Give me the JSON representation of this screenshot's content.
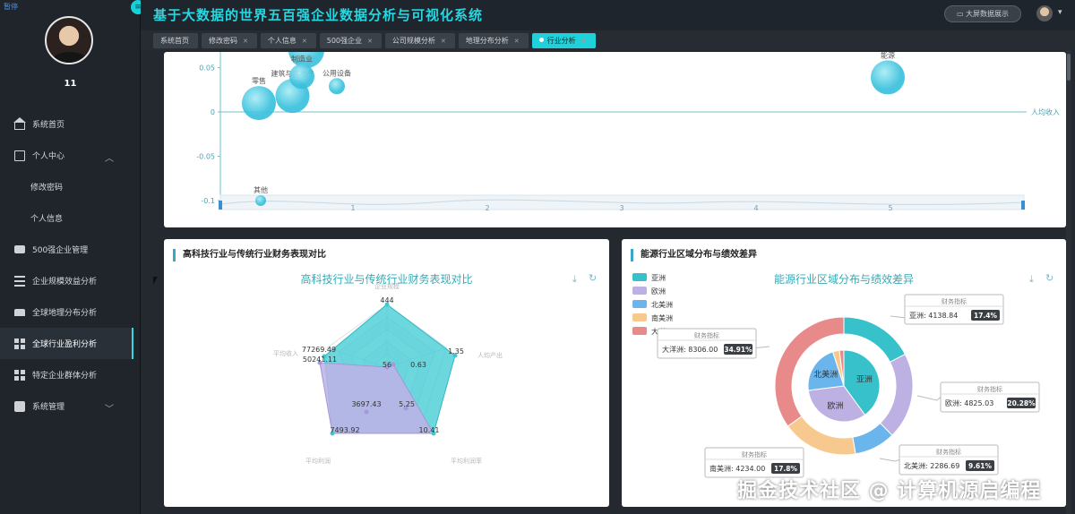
{
  "sidebar": {
    "pause_label": "暂停",
    "user_name": "11",
    "items": [
      {
        "label": "系统首页",
        "icon": "home-icon"
      },
      {
        "label": "个人中心",
        "icon": "user-center-icon",
        "expanded": true
      },
      {
        "label": "修改密码",
        "sub": true
      },
      {
        "label": "个人信息",
        "sub": true
      },
      {
        "label": "500强企业管理",
        "icon": "company-icon"
      },
      {
        "label": "企业规模效益分析",
        "icon": "list-icon"
      },
      {
        "label": "全球地理分布分析",
        "icon": "pin-icon"
      },
      {
        "label": "全球行业盈利分析",
        "icon": "grid-icon",
        "active": true
      },
      {
        "label": "特定企业群体分析",
        "icon": "grid-icon"
      },
      {
        "label": "系统管理",
        "icon": "clipboard-icon",
        "collapsible": true
      }
    ]
  },
  "header": {
    "title": "基于大数据的世界五百强企业数据分析与可视化系统",
    "big_screen_label": "大屏数据展示"
  },
  "tabs": [
    {
      "label": "系统首页"
    },
    {
      "label": "修改密码"
    },
    {
      "label": "个人信息"
    },
    {
      "label": "500强企业"
    },
    {
      "label": "公司规模分析"
    },
    {
      "label": "地理分布分析"
    },
    {
      "label": "行业分析",
      "active": true
    }
  ],
  "scatter_panel": {
    "chart_data": {
      "type": "scatter",
      "x_axis_label": "人均收入",
      "yticks": [
        "0.05",
        "0",
        "-0.05",
        "-0.1"
      ],
      "xticks": [
        "1",
        "2",
        "3",
        "4",
        "5"
      ],
      "points": [
        {
          "label": "零售",
          "x": 0.3,
          "y": 0.01,
          "size": 38
        },
        {
          "label": "建筑与房地产",
          "x": 0.55,
          "y": 0.018,
          "size": 38
        },
        {
          "label": "制造业",
          "x": 0.62,
          "y": 0.04,
          "size": 28
        },
        {
          "label": "公用设备",
          "x": 0.88,
          "y": 0.029,
          "size": 18
        },
        {
          "label": "能源",
          "x": 4.98,
          "y": 0.039,
          "size": 38
        },
        {
          "label": "其他",
          "x": 0.3,
          "y": -0.1,
          "size": 12
        }
      ]
    }
  },
  "radar_panel": {
    "panel_title": "高科技行业与传统行业财务表现对比",
    "chart_title": "高科技行业与传统行业财务表现对比",
    "chart_data": {
      "type": "radar",
      "indicators": [
        "企业规模",
        "人均产出",
        "平均利润率",
        "平均利润",
        "平均收入"
      ],
      "series": [
        {
          "values_label": [
            "444",
            "1.35",
            "10.41",
            "7493.92",
            "77269.49"
          ],
          "color": "#38c6d0"
        },
        {
          "values_label": [
            "56",
            "0.63",
            "5.25",
            "3697.43",
            "50241.11"
          ],
          "color": "#b9abe0"
        }
      ]
    }
  },
  "donut_panel": {
    "panel_title": "能源行业区域分布与绩效差异",
    "chart_title": "能源行业区域分布与绩效差异",
    "legend": [
      {
        "name": "亚洲",
        "color": "#36c1cb"
      },
      {
        "name": "欧洲",
        "color": "#bdb1e3"
      },
      {
        "name": "北美洲",
        "color": "#6ab5ec"
      },
      {
        "name": "南美洲",
        "color": "#f8c98f"
      },
      {
        "name": "大洋洲",
        "color": "#e98a8a"
      }
    ],
    "chart_data": {
      "type": "pie",
      "outer": [
        {
          "name": "亚洲",
          "value": 4138.84,
          "pct": "17.4%",
          "color": "#36c1cb"
        },
        {
          "name": "欧洲",
          "value": 4825.03,
          "pct": "20.28%",
          "color": "#bdb1e3"
        },
        {
          "name": "北美洲",
          "value": 2286.69,
          "pct": "9.61%",
          "color": "#6ab5ec"
        },
        {
          "name": "南美洲",
          "value": 4234.0,
          "pct": "17.8%",
          "color": "#f8c98f"
        },
        {
          "name": "大洋洲",
          "value": 8306.0,
          "pct": "34.91%",
          "color": "#e98a8a"
        }
      ],
      "inner": [
        {
          "name": "亚洲",
          "value": 40,
          "color": "#36c1cb"
        },
        {
          "name": "欧洲",
          "value": 33,
          "color": "#bdb1e3"
        },
        {
          "name": "北美洲",
          "value": 22,
          "color": "#6ab5ec"
        },
        {
          "name": "南美洲",
          "value": 3,
          "color": "#f8c98f"
        },
        {
          "name": "大洋洲",
          "value": 2,
          "color": "#e98a8a"
        }
      ],
      "tooltip_title": "财务指标",
      "tooltips": [
        {
          "text": "亚洲: 4138.84",
          "pct": "17.4%"
        },
        {
          "text": "欧洲: 4825.03",
          "pct": "20.28%"
        },
        {
          "text": "北美洲: 2286.69",
          "pct": "9.61%"
        },
        {
          "text": "南美洲: 4234.00",
          "pct": "17.8%"
        },
        {
          "text": "大洋洲: 8306.00",
          "pct": "34.91%"
        }
      ]
    }
  },
  "watermark": "掘金技术社区 @ 计算机源启编程"
}
